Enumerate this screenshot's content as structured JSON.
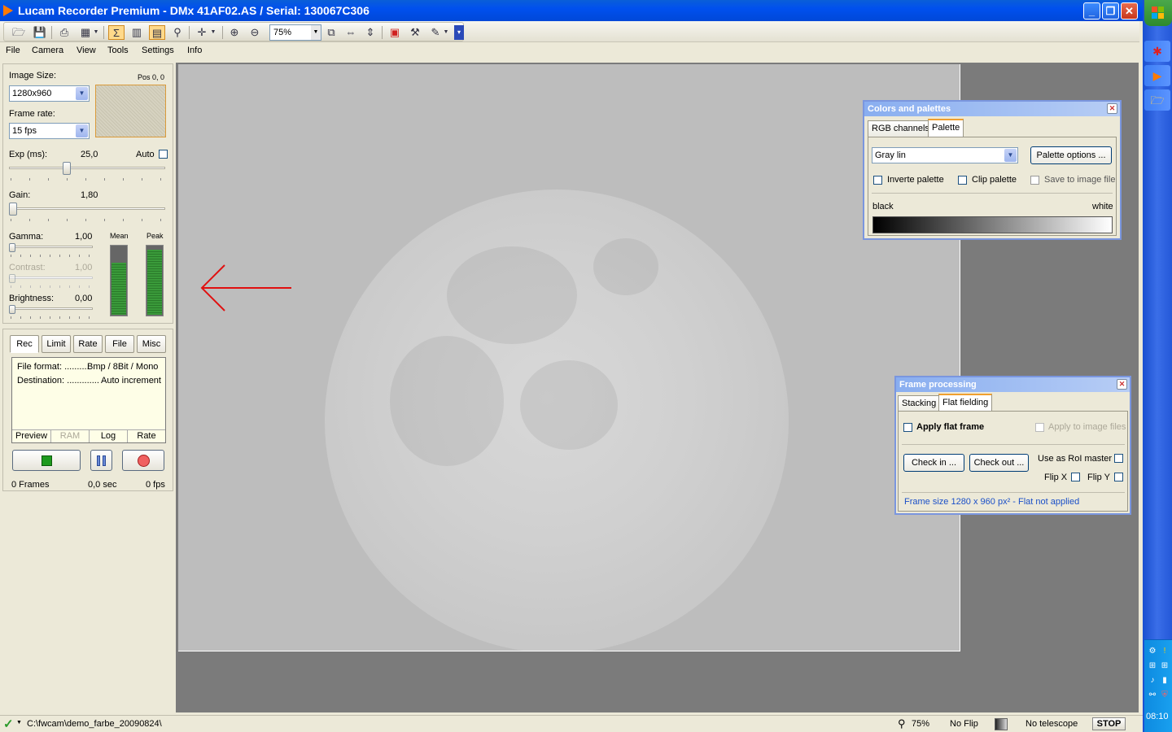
{
  "window": {
    "title": "Lucam Recorder Premium - DMx 41AF02.AS / Serial: 130067C306",
    "minimize_label": "_",
    "maximize_label": "❐",
    "close_label": "✕"
  },
  "toolbar": {
    "zoom_value": "75%"
  },
  "menu": {
    "items": [
      "File",
      "Camera",
      "View",
      "Tools",
      "Settings",
      "Info"
    ]
  },
  "controls": {
    "image_size_label": "Image Size:",
    "image_size_value": "1280x960",
    "pos_label": "Pos 0, 0",
    "frame_rate_label": "Frame rate:",
    "frame_rate_value": "15 fps",
    "exp_label": "Exp (ms):",
    "exp_value": "25,0",
    "exp_fraction": 0.36,
    "auto_label": "Auto",
    "gain_label": "Gain:",
    "gain_value": "1,80",
    "gain_fraction": 0.0,
    "gamma_label": "Gamma:",
    "gamma_value": "1,00",
    "contrast_label": "Contrast:",
    "contrast_value": "1,00",
    "brightness_label": "Brightness:",
    "brightness_value": "0,00",
    "mean_label": "Mean",
    "mean_fraction": 0.74,
    "peak_label": "Peak",
    "peak_fraction": 0.93
  },
  "recorder": {
    "tabs": [
      "Rec",
      "Limit",
      "Rate",
      "File",
      "Misc"
    ],
    "file_format_label": "File format: ..........",
    "file_format_value": "Bmp / 8Bit / Mono",
    "destination_label": "Destination: .............",
    "destination_value": "Auto increment",
    "subtabs": [
      "Preview",
      "RAM",
      "Log",
      "Rate"
    ],
    "frames": "0 Frames",
    "seconds": "0,0 sec",
    "fps": "0 fps"
  },
  "colors_dialog": {
    "title": "Colors and palettes",
    "tabs": [
      "RGB channels",
      "Palette"
    ],
    "palette_value": "Gray lin",
    "palette_options_label": "Palette options ...",
    "invert_label": "Inverte palette",
    "clip_label": "Clip palette",
    "save_label": "Save to image file",
    "black_label": "black",
    "white_label": "white"
  },
  "frame_dialog": {
    "title": "Frame processing",
    "tabs": [
      "Stacking",
      "Flat fielding"
    ],
    "apply_flat_label": "Apply flat frame",
    "apply_to_files_label": "Apply to image files",
    "check_in_label": "Check in ...",
    "check_out_label": "Check out ...",
    "roi_master_label": "Use as RoI master",
    "flip_x_label": "Flip X",
    "flip_y_label": "Flip Y",
    "status_text": "Frame size 1280 x 960 px² - Flat not applied"
  },
  "statusbar": {
    "path": "C:\\fwcam\\demo_farbe_20090824\\",
    "zoom": "75%",
    "flip": "No Flip",
    "telescope": "No telescope",
    "stop_label": "STOP"
  },
  "taskbar": {
    "clock": "08:10"
  },
  "colors": {
    "accent": "#0050ee",
    "annotation_arrow": "#e01010",
    "rec_button_fill": "#1e9a1e"
  }
}
